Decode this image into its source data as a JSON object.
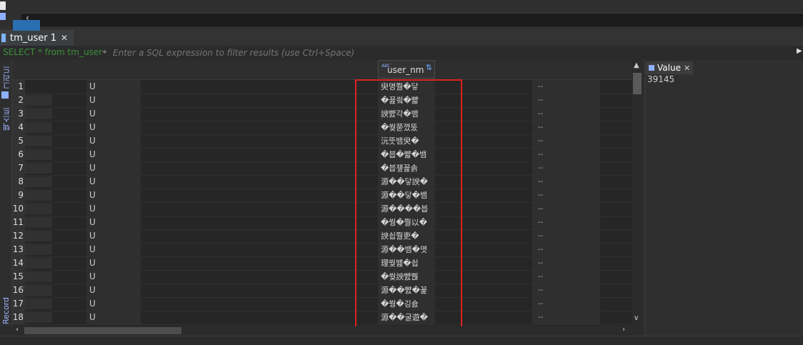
{
  "tab": {
    "title": "tm_user 1"
  },
  "filter": {
    "sql": "SELECT * from tm_user",
    "placeholder": "Enter a SQL expression to filter results (use Ctrl+Space)"
  },
  "grid": {
    "column_header": "user_nm",
    "rows": [
      {
        "num": "1",
        "u": "U",
        "nm": "臾명쭬�닿",
        "dash": "--"
      },
      {
        "num": "2",
        "u": "U",
        "nm": "�꾪쑄�뺣",
        "dash": "--"
      },
      {
        "num": "3",
        "u": "U",
        "nm": "諛뺤각�뱀",
        "dash": "--"
      },
      {
        "num": "4",
        "u": "U",
        "nm": "�쒖쭏꼈뚰",
        "dash": "--"
      },
      {
        "num": "5",
        "u": "U",
        "nm": "沅뚯뱀臾�",
        "dash": "--"
      },
      {
        "num": "6",
        "u": "U",
        "nm": "�븝�뺣�뱀",
        "dash": "--"
      },
      {
        "num": "7",
        "u": "U",
        "nm": "�븝쟾꾪솕",
        "dash": "--"
      },
      {
        "num": "8",
        "u": "U",
        "nm": "源��닿諛�",
        "dash": "--"
      },
      {
        "num": "9",
        "u": "U",
        "nm": "源��닿�뱀",
        "dash": "--"
      },
      {
        "num": "10",
        "u": "U",
        "nm": "源����븝",
        "dash": "--"
      },
      {
        "num": "11",
        "u": "U",
        "nm": "�쒕�쭬以�",
        "dash": "--"
      },
      {
        "num": "12",
        "u": "U",
        "nm": "諛쇱쭬吏�",
        "dash": "--"
      },
      {
        "num": "13",
        "u": "U",
        "nm": "源��뱀�몃",
        "dash": "--"
      },
      {
        "num": "14",
        "u": "U",
        "nm": "理쒖뱶�쇱",
        "dash": "--"
      },
      {
        "num": "15",
        "u": "U",
        "nm": "�쒖諛뺤뿭",
        "dash": "--"
      },
      {
        "num": "16",
        "u": "U",
        "nm": "源��뺤�꾩",
        "dash": "--"
      },
      {
        "num": "17",
        "u": "U",
        "nm": "�쒕�깅숈",
        "dash": "--"
      },
      {
        "num": "18",
        "u": "U",
        "nm": "源��굴遊�",
        "dash": "--"
      }
    ]
  },
  "value_panel": {
    "title": "Value",
    "value": "39145"
  },
  "sidebar": {
    "record_label": "Record",
    "grid_label": "그리드",
    "text_label": "텍스트"
  }
}
